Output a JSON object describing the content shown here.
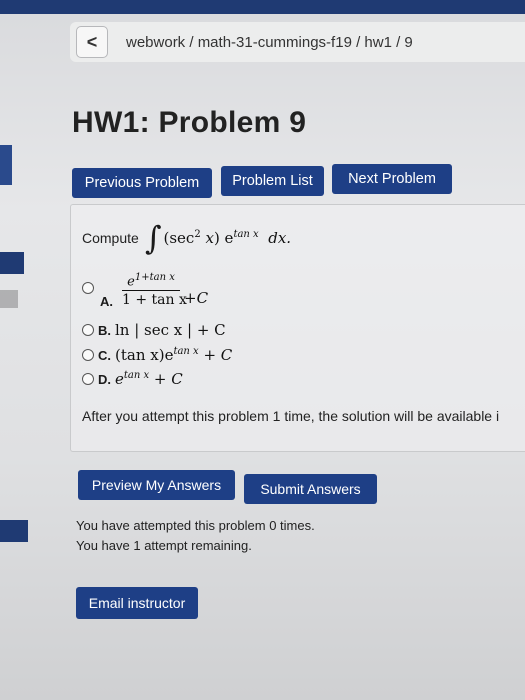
{
  "breadcrumb": {
    "back_icon": "chevron-left-icon",
    "back_glyph": "<",
    "path": "webwork / math-31-cummings-f19 / hw1 / 9"
  },
  "page_title": "HW1: Problem 9",
  "nav": {
    "previous": "Previous Problem",
    "list": "Problem List",
    "next": "Next Problem"
  },
  "problem": {
    "prompt": "Compute",
    "integral_symbol": "∫",
    "integrand_open": "(sec",
    "sec_exp": "2",
    "integrand_var": "x",
    "integrand_close": ") e",
    "exp_term": "tan x",
    "differential": "dx."
  },
  "choices": {
    "a": {
      "letter": "A.",
      "numerator_base": "e",
      "numerator_exp": "1+tan x",
      "denominator": "1 + tan x",
      "tail": "+C"
    },
    "b": {
      "letter": "B.",
      "expr": "ln | sec x | + C"
    },
    "c": {
      "letter": "C.",
      "expr_main": "(tan x)e",
      "expr_exp": "tan x",
      "tail": " + C"
    },
    "d": {
      "letter": "D.",
      "expr_main": "e",
      "expr_exp": "tan x",
      "tail": " + C"
    }
  },
  "after_message": "After you attempt this problem 1 time, the solution will be available i",
  "actions": {
    "preview": "Preview My Answers",
    "submit": "Submit Answers"
  },
  "attempts": {
    "line1": "You have attempted this problem 0 times.",
    "line2": "You have 1 attempt remaining."
  },
  "email": "Email instructor",
  "colors": {
    "button_bg": "#1e3f86",
    "topbar": "#1f3a73"
  }
}
